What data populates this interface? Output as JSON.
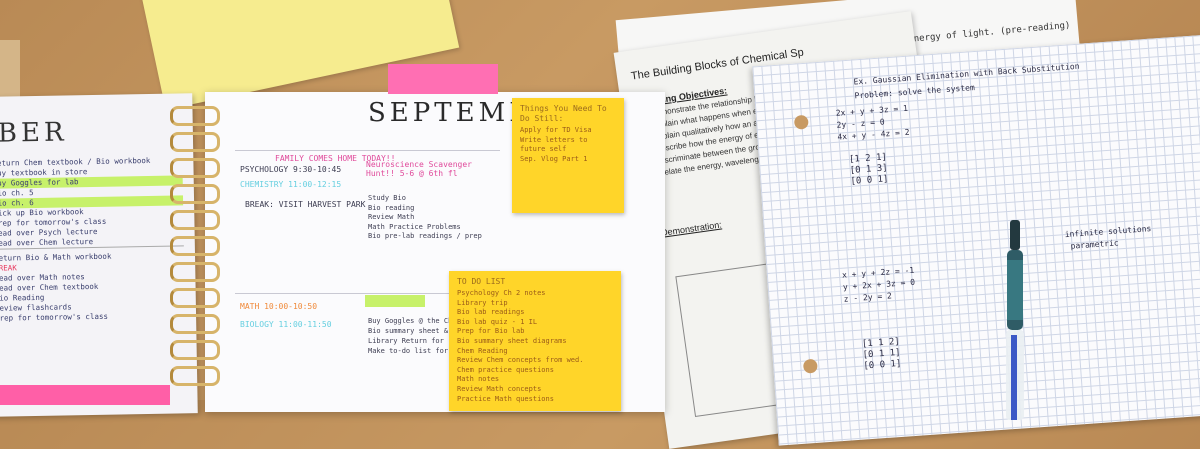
{
  "left_page": {
    "month": "BER",
    "lines": [
      "Return Chem textbook / Bio workbook",
      "Buy textbook in store",
      "Buy Goggles for lab",
      "Bio ch. 5",
      "Bio ch. 6",
      "Pick up Bio workbook",
      "Prep for tomorrow's class",
      "Read over Psych lecture",
      "Read over Chem lecture",
      "Return Bio & Math workbook",
      "BREAK",
      "Read over Math notes",
      "Read over Chem textbook",
      "Bio Reading",
      "Review flashcards",
      "Prep for tomorrow's class"
    ]
  },
  "planner": {
    "month": "SEPTEMBER",
    "banner": "FAMILY COMES HOME TODAY!!",
    "events": [
      {
        "label": "PSYCHOLOGY 9:30-10:45",
        "color": "dark"
      },
      {
        "label": "CHEMISTRY 11:00-12:15",
        "color": "teal"
      },
      {
        "label": "BREAK: VISIT HARVEST PARK",
        "color": "dark"
      },
      {
        "label": "MATH 10:00-10:50",
        "color": "orange"
      },
      {
        "label": "BIOLOGY 11:00-11:50",
        "color": "teal"
      }
    ],
    "notes_a": [
      "Neuroscience Scavenger",
      "Hunt!! 5-6 @ 6th fl"
    ],
    "tasks_a": [
      "Study Bio",
      "Bio reading",
      "Review Math",
      "Math Practice Problems",
      "Bio pre-lab readings / prep"
    ],
    "tasks_b": [
      "Buy Goggles @ the Chem",
      "Bio summary sheet & diagrams",
      "Library Return for",
      "Make to-do list for entire weekend"
    ]
  },
  "sticky_top": {
    "title": "Things You Need To Do Still:",
    "items": [
      "Apply for TD Visa",
      "Write letters to future self",
      "Sep. Vlog Part 1"
    ]
  },
  "sticky_todo": {
    "title": "TO DO LIST",
    "items": [
      "Psychology Ch 2 notes",
      "Library trip",
      "Bio lab readings",
      "Bio lab quiz - 1 IL",
      "Prep for Bio lab",
      "Bio summary sheet diagrams",
      "Chem Reading",
      "Review Chem concepts from wed.",
      "Chem practice questions",
      "Math notes",
      "Review Math concepts",
      "Practice Math questions"
    ]
  },
  "handout": {
    "title": "The Building Blocks of Chemical Sp",
    "objectives_label": "Learning Objectives:",
    "objectives": [
      "Demonstrate the relationship betwee",
      "Explain what happens when energy",
      "Explain qualitatively how an atom",
      "Describe how the energy of elect",
      "Discriminate between the ground",
      "Relate the energy, wavelength diagram for this atom."
    ],
    "demo_label": "Demonstration:",
    "note": "energy of light. (pre-reading)"
  },
  "grid_paper": {
    "header": "Ex. Gaussian Elimination with Back Substitution",
    "problem": "Problem: solve the system",
    "lines": [
      "2x + y + 3z = 1",
      "2y - z = 0",
      "4x + y - 4z = 2",
      "x + y + 2z = -1",
      "y + 2x + 3z = 0",
      "z - 2y = 2"
    ],
    "infinite": "infinite solutions",
    "parametric": "parametric"
  },
  "colors": {
    "sticky_yellow": "#ffd529",
    "tab_pink": "#ff6fb3",
    "highlighter_green": "#c7f16a",
    "wood": "#b98a55"
  }
}
